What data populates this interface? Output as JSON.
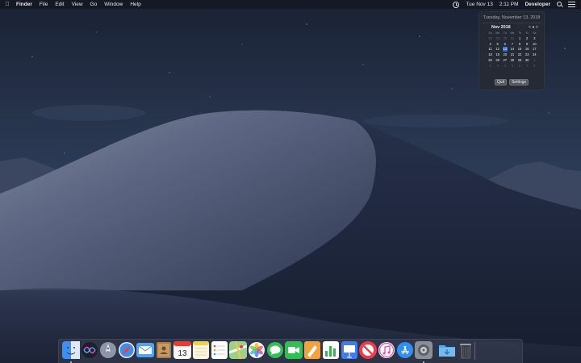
{
  "menubar": {
    "apple_icon": "apple-logo-icon",
    "app_name": "Finder",
    "menus": [
      "File",
      "Edit",
      "View",
      "Go",
      "Window",
      "Help"
    ],
    "status": {
      "clock_icon": "clock-icon",
      "date": "Tue Nov 13",
      "time": "2:11 PM",
      "user": "Developer",
      "search_icon": "spotlight-search-icon",
      "notification_icon": "notification-center-icon"
    }
  },
  "calendar_popover": {
    "full_date": "Tuesday, November 13, 2018",
    "month_title": "Nov 2018",
    "nav": {
      "prev": "<",
      "today": "●",
      "next": ">"
    },
    "weekdays": [
      "Su",
      "Mo",
      "Tu",
      "We",
      "Th",
      "Fr",
      "Sa"
    ],
    "days": [
      {
        "d": "28",
        "dim": true
      },
      {
        "d": "29",
        "dim": true
      },
      {
        "d": "30",
        "dim": true
      },
      {
        "d": "31",
        "dim": true
      },
      {
        "d": "1"
      },
      {
        "d": "2"
      },
      {
        "d": "3"
      },
      {
        "d": "4"
      },
      {
        "d": "5"
      },
      {
        "d": "6"
      },
      {
        "d": "7"
      },
      {
        "d": "8"
      },
      {
        "d": "9"
      },
      {
        "d": "10"
      },
      {
        "d": "11"
      },
      {
        "d": "12"
      },
      {
        "d": "13",
        "today": true
      },
      {
        "d": "14"
      },
      {
        "d": "15"
      },
      {
        "d": "16"
      },
      {
        "d": "17"
      },
      {
        "d": "18"
      },
      {
        "d": "19"
      },
      {
        "d": "20"
      },
      {
        "d": "21"
      },
      {
        "d": "22"
      },
      {
        "d": "23"
      },
      {
        "d": "24"
      },
      {
        "d": "25"
      },
      {
        "d": "26"
      },
      {
        "d": "27"
      },
      {
        "d": "28"
      },
      {
        "d": "29"
      },
      {
        "d": "30"
      },
      {
        "d": "1",
        "dim": true
      },
      {
        "d": "2",
        "dim": true
      },
      {
        "d": "3",
        "dim": true
      },
      {
        "d": "4",
        "dim": true
      },
      {
        "d": "5",
        "dim": true
      },
      {
        "d": "6",
        "dim": true
      },
      {
        "d": "7",
        "dim": true
      },
      {
        "d": "8",
        "dim": true
      }
    ],
    "quit_label": "Quit",
    "settings_label": "Settings",
    "today_color": "#2a6ad8"
  },
  "dock": {
    "apps": [
      {
        "name": "finder",
        "icon": "finder-icon",
        "running": true
      },
      {
        "name": "siri",
        "icon": "siri-icon",
        "running": false
      },
      {
        "name": "launchpad",
        "icon": "launchpad-icon",
        "running": false
      },
      {
        "name": "safari",
        "icon": "safari-icon",
        "running": false
      },
      {
        "name": "mail",
        "icon": "mail-icon",
        "running": false
      },
      {
        "name": "contacts",
        "icon": "contacts-icon",
        "running": false
      },
      {
        "name": "calendar",
        "icon": "calendar-icon",
        "running": false,
        "label": "13"
      },
      {
        "name": "notes",
        "icon": "notes-icon",
        "running": false
      },
      {
        "name": "reminders",
        "icon": "reminders-icon",
        "running": false
      },
      {
        "name": "maps",
        "icon": "maps-icon",
        "running": false
      },
      {
        "name": "photos",
        "icon": "photos-icon",
        "running": false
      },
      {
        "name": "messages",
        "icon": "messages-icon",
        "running": false
      },
      {
        "name": "facetime",
        "icon": "facetime-icon",
        "running": false
      },
      {
        "name": "pages",
        "icon": "pages-icon",
        "running": false
      },
      {
        "name": "numbers",
        "icon": "numbers-icon",
        "running": false
      },
      {
        "name": "keynote",
        "icon": "keynote-icon",
        "running": false
      },
      {
        "name": "news",
        "icon": "news-icon",
        "running": false
      },
      {
        "name": "itunes",
        "icon": "itunes-icon",
        "running": false
      },
      {
        "name": "app-store",
        "icon": "app-store-icon",
        "running": false
      },
      {
        "name": "system-preferences",
        "icon": "system-preferences-icon",
        "running": true
      },
      {
        "name": "downloads",
        "icon": "downloads-folder-icon",
        "running": false
      },
      {
        "name": "trash",
        "icon": "trash-icon",
        "running": false
      }
    ]
  }
}
